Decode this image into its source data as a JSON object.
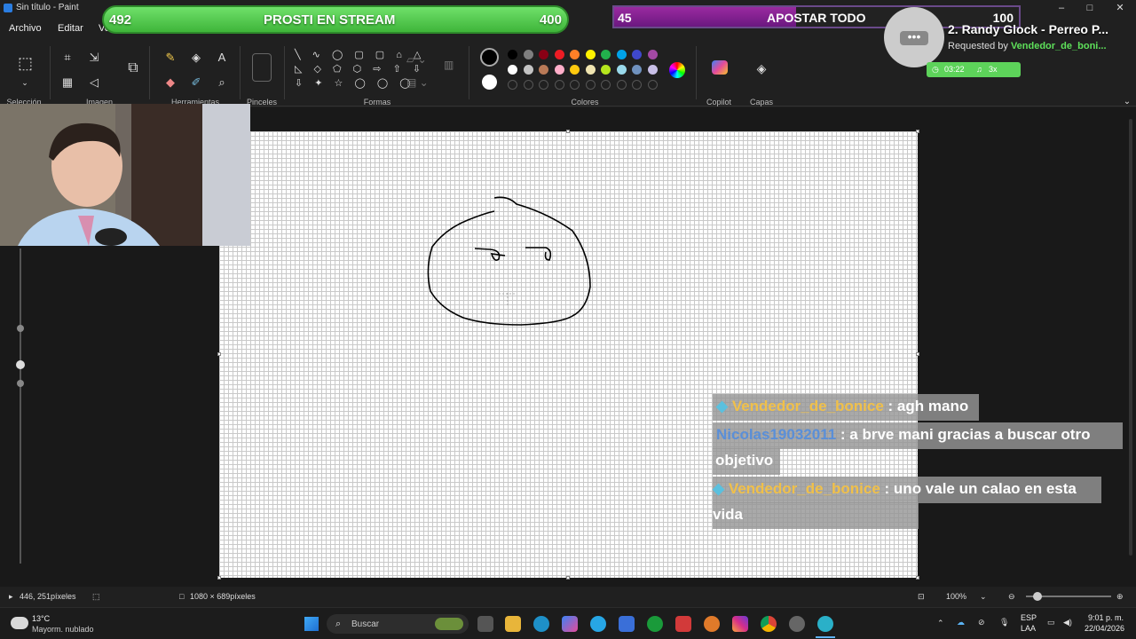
{
  "window": {
    "title": "Sin título - Paint",
    "minimize": "–",
    "maximize": "□",
    "close": "✕"
  },
  "menu": {
    "items": [
      "Archivo",
      "Editar",
      "Ver"
    ]
  },
  "ribbon": {
    "groups": {
      "selection": "Selección",
      "image": "Imagen",
      "tools": "Herramientas",
      "brushes": "Pinceles",
      "shapes": "Formas",
      "colors": "Colores",
      "copilot": "Copilot",
      "layers": "Capas"
    },
    "palette_row1": [
      "#000000",
      "#7f7f7f",
      "#880015",
      "#ed1c24",
      "#ff7f27",
      "#fff200",
      "#22b14c",
      "#00a2e8",
      "#3f48cc",
      "#a349a4"
    ],
    "palette_row2": [
      "#ffffff",
      "#c3c3c3",
      "#b97a57",
      "#ffaec9",
      "#ffc90e",
      "#efe4b0",
      "#b5e61d",
      "#99d9ea",
      "#7092be",
      "#c8bfe7"
    ],
    "primary_color": "#000000",
    "secondary_color": "#ffffff",
    "icons": [
      "select-icon",
      "crop-icon",
      "resize-icon",
      "rotate-icon",
      "image-search-icon",
      "image-bg-icon",
      "pencil-icon",
      "fill-icon",
      "text-icon",
      "eraser-icon",
      "color-picker-icon",
      "magnifier-icon",
      "brush-icon",
      "shapes-icon",
      "rainbow-icon",
      "copilot-icon",
      "layers-icon"
    ]
  },
  "overlay": {
    "bar_left": {
      "left_value": "492",
      "title": "PROSTI EN STREAM",
      "right_value": "400",
      "color": "#4cc247"
    },
    "bar_right": {
      "left_value": "45",
      "title": "APOSTAR TODO",
      "right_value": "100",
      "progress": 0.45,
      "color": "#8a2096"
    },
    "song": {
      "title": "2. Randy Glock - Perreo P...",
      "requested_prefix": "Requested by ",
      "requester": "Vendedor_de_boni...",
      "duration": "03:22",
      "plays": "3x"
    }
  },
  "chat": [
    {
      "user": "Vendedor_de_bonice",
      "user_color": "#f0c04a",
      "sep": " : ",
      "text": "agh mano",
      "badge": "diamond-icon"
    },
    {
      "user": "Nicolas19032011",
      "user_color": "#5a8fd8",
      "sep": " : ",
      "text": "a brve mani gracias a buscar otro",
      "cont": "objetivo"
    },
    {
      "user": "Vendedor_de_bonice",
      "user_color": "#f0c04a",
      "sep": " : ",
      "text": "uno vale un calao en esta",
      "cont": "vida",
      "badge": "diamond-icon"
    }
  ],
  "status": {
    "cursor_pos": "446, 251píxeles",
    "canvas_size": "1080 × 689píxeles",
    "zoom": "100%"
  },
  "taskbar": {
    "weather_temp": "13°C",
    "weather_desc": "Mayorm. nublado",
    "search_placeholder": "Buscar",
    "lang": "ESP",
    "lang2": "LAA",
    "time": "9:01 p. m.",
    "date": "22/04/2026"
  }
}
